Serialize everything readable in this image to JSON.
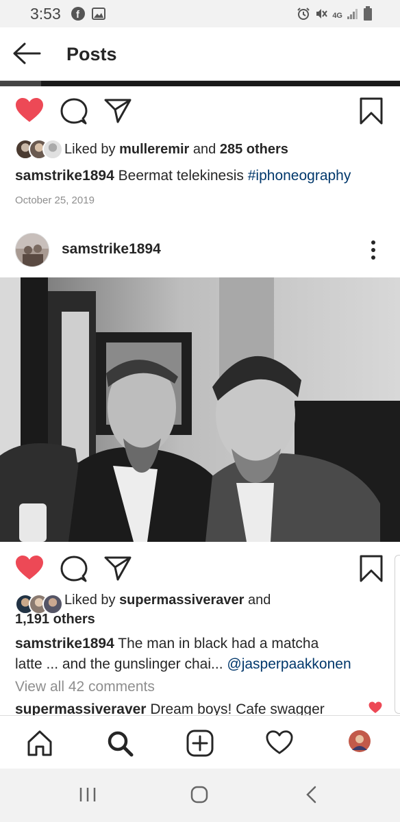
{
  "status_bar": {
    "time": "3:53",
    "left_icons": [
      "facebook-icon",
      "image-icon"
    ],
    "right_icons": [
      "alarm-icon",
      "mute-icon",
      "4g-lte-icon",
      "signal-icon",
      "battery-icon"
    ],
    "network": "4G"
  },
  "header": {
    "title": "Posts"
  },
  "post1": {
    "liked_by_prefix": "Liked by",
    "liked_by_user": "mulleremir",
    "liked_by_and": "and",
    "liked_by_others": "285 others",
    "caption_user": "samstrike1894",
    "caption_text": "Beermat telekinesis",
    "caption_tag": "#iphoneography",
    "date": "October 25, 2019"
  },
  "post2": {
    "username": "samstrike1894",
    "liked_by_prefix": "Liked by",
    "liked_by_user": "supermassiveraver",
    "liked_by_and": "and",
    "liked_by_others": "1,191 others",
    "caption_user": "samstrike1894",
    "caption_text_line1": "The man in black had a matcha",
    "caption_text_line2": "latte ... and the gunslinger chai...",
    "caption_mention": "@jasperpaakkonen",
    "view_comments": "View all 42 comments",
    "comment_user": "supermassiveraver",
    "comment_text": "Dream boys! Cafe swagger"
  },
  "bottom_nav": [
    "home-icon",
    "search-icon",
    "add-post-icon",
    "activity-heart-icon",
    "profile-avatar"
  ],
  "colors": {
    "like_red": "#ed4956",
    "link_blue": "#00376b",
    "text": "#262626",
    "muted": "#8e8e8e"
  }
}
